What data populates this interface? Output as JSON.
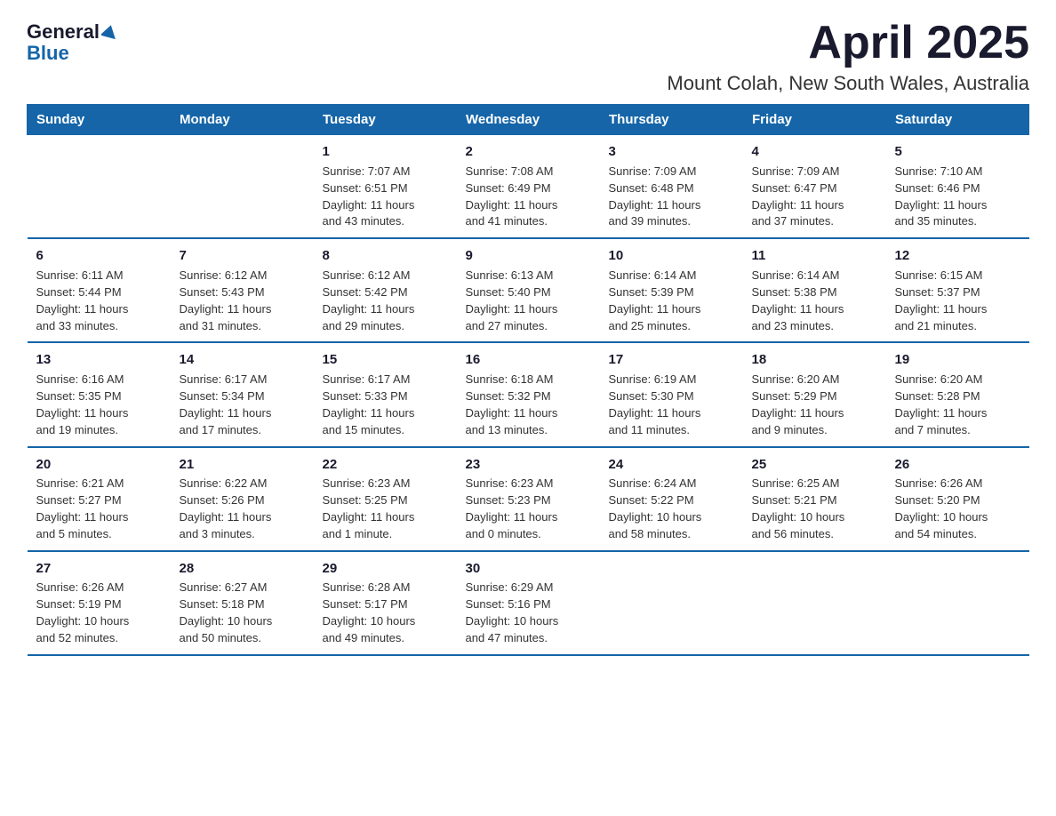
{
  "logo": {
    "general": "General",
    "blue": "Blue"
  },
  "title": "April 2025",
  "location": "Mount Colah, New South Wales, Australia",
  "days_of_week": [
    "Sunday",
    "Monday",
    "Tuesday",
    "Wednesday",
    "Thursday",
    "Friday",
    "Saturday"
  ],
  "weeks": [
    [
      {
        "day": "",
        "info": ""
      },
      {
        "day": "",
        "info": ""
      },
      {
        "day": "1",
        "info": "Sunrise: 7:07 AM\nSunset: 6:51 PM\nDaylight: 11 hours\nand 43 minutes."
      },
      {
        "day": "2",
        "info": "Sunrise: 7:08 AM\nSunset: 6:49 PM\nDaylight: 11 hours\nand 41 minutes."
      },
      {
        "day": "3",
        "info": "Sunrise: 7:09 AM\nSunset: 6:48 PM\nDaylight: 11 hours\nand 39 minutes."
      },
      {
        "day": "4",
        "info": "Sunrise: 7:09 AM\nSunset: 6:47 PM\nDaylight: 11 hours\nand 37 minutes."
      },
      {
        "day": "5",
        "info": "Sunrise: 7:10 AM\nSunset: 6:46 PM\nDaylight: 11 hours\nand 35 minutes."
      }
    ],
    [
      {
        "day": "6",
        "info": "Sunrise: 6:11 AM\nSunset: 5:44 PM\nDaylight: 11 hours\nand 33 minutes."
      },
      {
        "day": "7",
        "info": "Sunrise: 6:12 AM\nSunset: 5:43 PM\nDaylight: 11 hours\nand 31 minutes."
      },
      {
        "day": "8",
        "info": "Sunrise: 6:12 AM\nSunset: 5:42 PM\nDaylight: 11 hours\nand 29 minutes."
      },
      {
        "day": "9",
        "info": "Sunrise: 6:13 AM\nSunset: 5:40 PM\nDaylight: 11 hours\nand 27 minutes."
      },
      {
        "day": "10",
        "info": "Sunrise: 6:14 AM\nSunset: 5:39 PM\nDaylight: 11 hours\nand 25 minutes."
      },
      {
        "day": "11",
        "info": "Sunrise: 6:14 AM\nSunset: 5:38 PM\nDaylight: 11 hours\nand 23 minutes."
      },
      {
        "day": "12",
        "info": "Sunrise: 6:15 AM\nSunset: 5:37 PM\nDaylight: 11 hours\nand 21 minutes."
      }
    ],
    [
      {
        "day": "13",
        "info": "Sunrise: 6:16 AM\nSunset: 5:35 PM\nDaylight: 11 hours\nand 19 minutes."
      },
      {
        "day": "14",
        "info": "Sunrise: 6:17 AM\nSunset: 5:34 PM\nDaylight: 11 hours\nand 17 minutes."
      },
      {
        "day": "15",
        "info": "Sunrise: 6:17 AM\nSunset: 5:33 PM\nDaylight: 11 hours\nand 15 minutes."
      },
      {
        "day": "16",
        "info": "Sunrise: 6:18 AM\nSunset: 5:32 PM\nDaylight: 11 hours\nand 13 minutes."
      },
      {
        "day": "17",
        "info": "Sunrise: 6:19 AM\nSunset: 5:30 PM\nDaylight: 11 hours\nand 11 minutes."
      },
      {
        "day": "18",
        "info": "Sunrise: 6:20 AM\nSunset: 5:29 PM\nDaylight: 11 hours\nand 9 minutes."
      },
      {
        "day": "19",
        "info": "Sunrise: 6:20 AM\nSunset: 5:28 PM\nDaylight: 11 hours\nand 7 minutes."
      }
    ],
    [
      {
        "day": "20",
        "info": "Sunrise: 6:21 AM\nSunset: 5:27 PM\nDaylight: 11 hours\nand 5 minutes."
      },
      {
        "day": "21",
        "info": "Sunrise: 6:22 AM\nSunset: 5:26 PM\nDaylight: 11 hours\nand 3 minutes."
      },
      {
        "day": "22",
        "info": "Sunrise: 6:23 AM\nSunset: 5:25 PM\nDaylight: 11 hours\nand 1 minute."
      },
      {
        "day": "23",
        "info": "Sunrise: 6:23 AM\nSunset: 5:23 PM\nDaylight: 11 hours\nand 0 minutes."
      },
      {
        "day": "24",
        "info": "Sunrise: 6:24 AM\nSunset: 5:22 PM\nDaylight: 10 hours\nand 58 minutes."
      },
      {
        "day": "25",
        "info": "Sunrise: 6:25 AM\nSunset: 5:21 PM\nDaylight: 10 hours\nand 56 minutes."
      },
      {
        "day": "26",
        "info": "Sunrise: 6:26 AM\nSunset: 5:20 PM\nDaylight: 10 hours\nand 54 minutes."
      }
    ],
    [
      {
        "day": "27",
        "info": "Sunrise: 6:26 AM\nSunset: 5:19 PM\nDaylight: 10 hours\nand 52 minutes."
      },
      {
        "day": "28",
        "info": "Sunrise: 6:27 AM\nSunset: 5:18 PM\nDaylight: 10 hours\nand 50 minutes."
      },
      {
        "day": "29",
        "info": "Sunrise: 6:28 AM\nSunset: 5:17 PM\nDaylight: 10 hours\nand 49 minutes."
      },
      {
        "day": "30",
        "info": "Sunrise: 6:29 AM\nSunset: 5:16 PM\nDaylight: 10 hours\nand 47 minutes."
      },
      {
        "day": "",
        "info": ""
      },
      {
        "day": "",
        "info": ""
      },
      {
        "day": "",
        "info": ""
      }
    ]
  ]
}
